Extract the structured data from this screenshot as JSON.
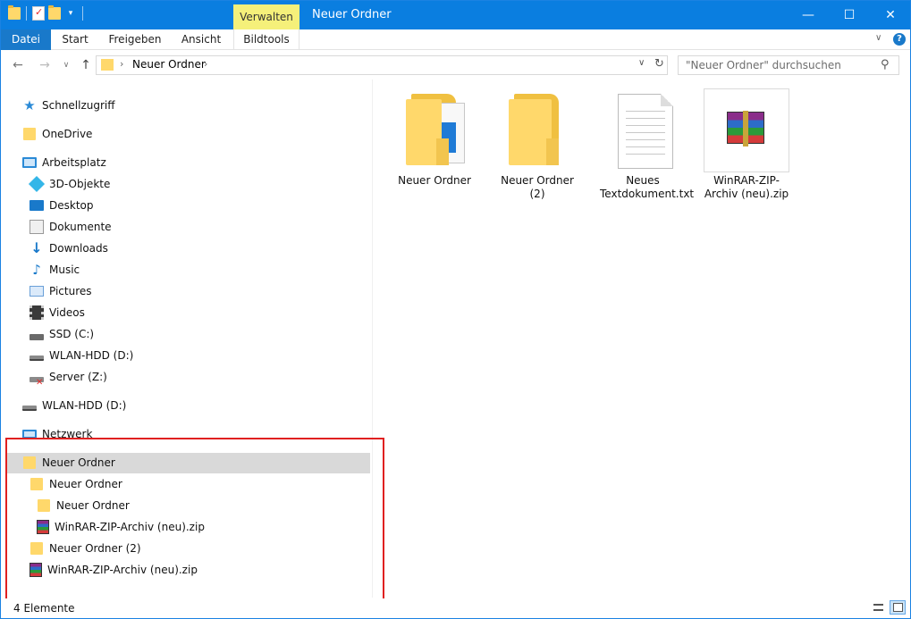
{
  "title_bar": {
    "contextual_tab": "Verwalten",
    "window_title": "Neuer Ordner",
    "minimize_glyph": "—",
    "maximize_glyph": "☐",
    "close_glyph": "✕"
  },
  "ribbon": {
    "tabs": [
      "Datei",
      "Start",
      "Freigeben",
      "Ansicht",
      "Bildtools"
    ],
    "active_tab": "Datei",
    "collapse_glyph": "∨",
    "help_glyph": "?"
  },
  "navigation": {
    "back_glyph": "←",
    "forward_glyph": "→",
    "recent_glyph": "∨",
    "up_glyph": "↑",
    "address": {
      "separator": "›",
      "path": "Neuer Ordner",
      "dropdown_glyph": "∨",
      "refresh_glyph": "↻"
    },
    "search": {
      "placeholder": "\"Neuer Ordner\" durchsuchen",
      "search_glyph": "⚲"
    }
  },
  "sidebar": {
    "items": [
      {
        "label": "Schnellzugriff",
        "icon": "star-icon"
      },
      {
        "label": "OneDrive",
        "icon": "folder-icon"
      },
      {
        "label": "Arbeitsplatz",
        "icon": "computer-icon"
      },
      {
        "label": "3D-Objekte",
        "icon": "3d-objects-icon"
      },
      {
        "label": "Desktop",
        "icon": "desktop-icon"
      },
      {
        "label": "Dokumente",
        "icon": "documents-icon"
      },
      {
        "label": "Downloads",
        "icon": "downloads-icon"
      },
      {
        "label": "Music",
        "icon": "music-icon"
      },
      {
        "label": "Pictures",
        "icon": "pictures-icon"
      },
      {
        "label": "Videos",
        "icon": "videos-icon"
      },
      {
        "label": "SSD (C:)",
        "icon": "ssd-drive-icon"
      },
      {
        "label": "WLAN-HDD (D:)",
        "icon": "hdd-drive-icon"
      },
      {
        "label": "Server (Z:)",
        "icon": "disconnected-drive-icon"
      },
      {
        "label": "WLAN-HDD (D:)",
        "icon": "hdd-drive-icon"
      },
      {
        "label": "Netzwerk",
        "icon": "network-icon"
      },
      {
        "label": "Neuer Ordner",
        "icon": "folder-icon",
        "selected": true
      },
      {
        "label": "Neuer Ordner",
        "icon": "folder-icon"
      },
      {
        "label": "Neuer Ordner",
        "icon": "folder-icon"
      },
      {
        "label": "WinRAR-ZIP-Archiv (neu).zip",
        "icon": "winrar-archive-icon"
      },
      {
        "label": "Neuer Ordner (2)",
        "icon": "folder-icon"
      },
      {
        "label": "WinRAR-ZIP-Archiv (neu).zip",
        "icon": "winrar-archive-icon"
      }
    ]
  },
  "content": {
    "files": [
      {
        "name": "Neuer Ordner",
        "type": "folder-with-content"
      },
      {
        "name": "Neuer Ordner (2)",
        "type": "empty-folder"
      },
      {
        "name": "Neues Textdokument.txt",
        "type": "text-document"
      },
      {
        "name": "WinRAR-ZIP-Archiv (neu).zip",
        "type": "winrar-archive"
      }
    ]
  },
  "status_bar": {
    "item_count": "4 Elemente"
  },
  "colors": {
    "title_bar": "#0a7ee0",
    "contextual_tab": "#f5f07a",
    "selection": "#d9d9d9",
    "highlight_box": "#e02020"
  }
}
